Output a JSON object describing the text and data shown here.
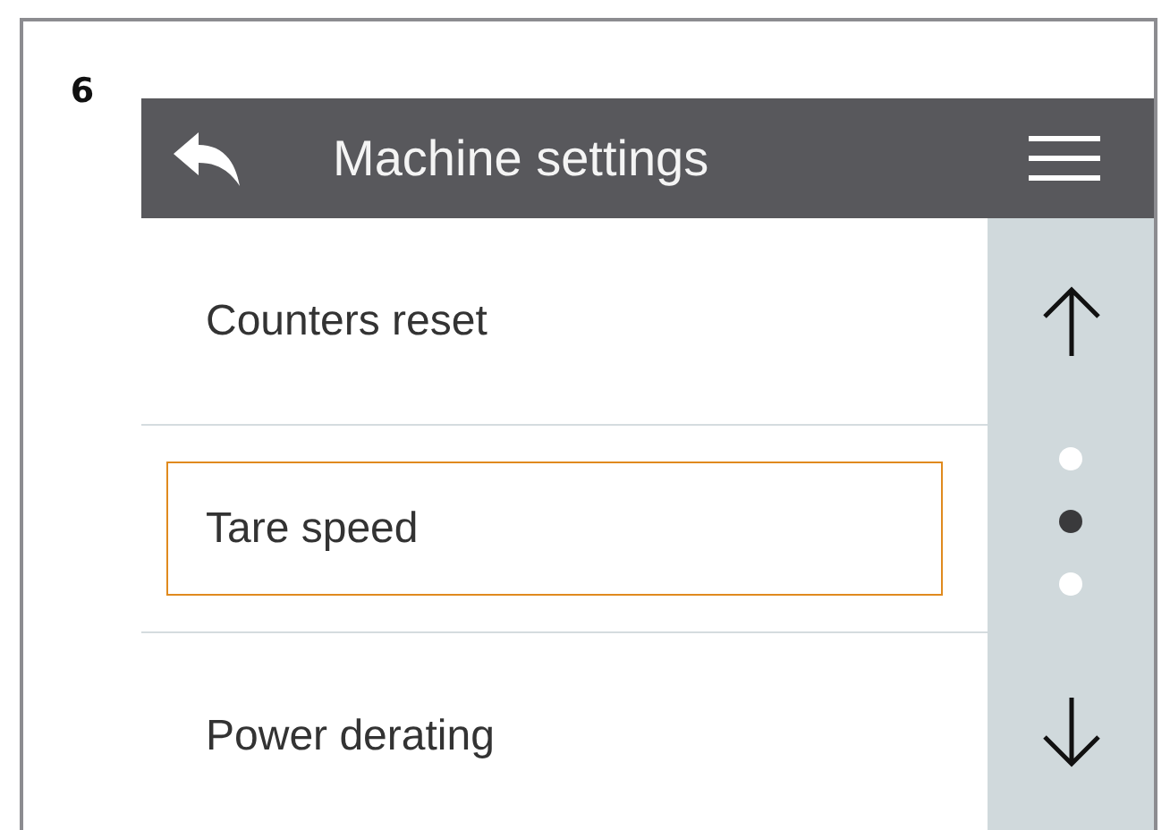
{
  "figure_number": "6",
  "header": {
    "title": "Machine settings"
  },
  "items": [
    {
      "label": "Counters reset",
      "selected": false
    },
    {
      "label": "Tare speed",
      "selected": true
    },
    {
      "label": "Power derating",
      "selected": false
    }
  ],
  "page_dots": [
    {
      "selected": false
    },
    {
      "selected": true
    },
    {
      "selected": false
    }
  ]
}
